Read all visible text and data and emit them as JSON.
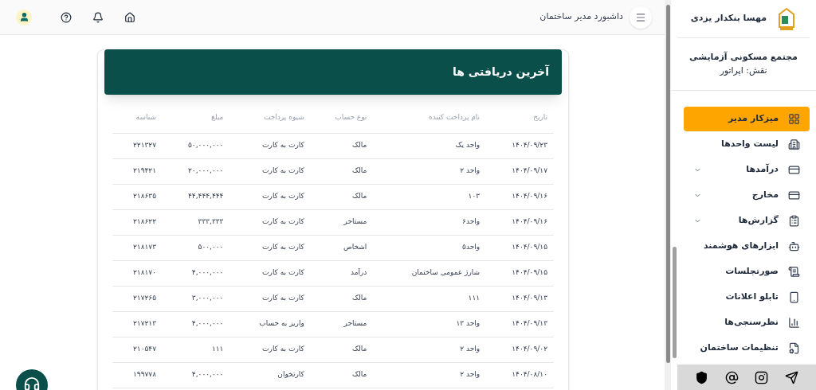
{
  "header": {
    "title": "داشبورد مدیر ساختمان"
  },
  "card": {
    "title": "آخرین دریافتی ها"
  },
  "table": {
    "columns": [
      "تاریخ",
      "نام پرداخت کننده",
      "نوع حساب",
      "شیوه پرداخت",
      "مبلغ",
      "شناسه"
    ],
    "rows": [
      [
        "۱۴۰۴/۰۹/۲۳",
        "واحد یک",
        "مالک",
        "کارت به کارت",
        "۵۰,۰۰۰,۰۰۰",
        "۲۲۱۳۲۷"
      ],
      [
        "۱۴۰۴/۰۹/۱۷",
        "واحد ۲",
        "مالک",
        "کارت به کارت",
        "۲۰,۰۰۰,۰۰۰",
        "۲۱۹۴۲۱"
      ],
      [
        "۱۴۰۴/۰۹/۱۶",
        "۱۰۳",
        "مالک",
        "کارت به کارت",
        "۴۴,۴۴۴,۴۴۴",
        "۲۱۸۶۳۵"
      ],
      [
        "۱۴۰۴/۰۹/۱۶",
        "واحد۶",
        "مستاجر",
        "کارت به کارت",
        "۳۳۳,۳۳۳",
        "۲۱۸۶۲۲"
      ],
      [
        "۱۴۰۴/۰۹/۱۵",
        "واحد۵",
        "اشخاص",
        "کارت به کارت",
        "۵۰۰,۰۰۰",
        "۲۱۸۱۷۳"
      ],
      [
        "۱۴۰۴/۰۹/۱۵",
        "شارژ عمومی ساختمان",
        "درآمد",
        "کارت به کارت",
        "۴,۰۰۰,۰۰۰",
        "۲۱۸۱۷۰"
      ],
      [
        "۱۴۰۴/۰۹/۱۳",
        "۱۱۱",
        "مالک",
        "کارت به کارت",
        "۳,۰۰۰,۰۰۰",
        "۲۱۷۲۶۵"
      ],
      [
        "۱۴۰۴/۰۹/۱۳",
        "واحد ۱۳",
        "مستاجر",
        "واریز به حساب",
        "۴,۰۰۰,۰۰۰",
        "۲۱۷۲۱۳"
      ],
      [
        "۱۴۰۴/۰۹/۰۲",
        "واحد ۲",
        "مالک",
        "کارت به کارت",
        "۱۱۱",
        "۲۱۰۵۴۷"
      ],
      [
        "۱۴۰۴/۰۸/۱۰",
        "واحد ۲",
        "مالک",
        "کارتخوان",
        "۴,۰۰۰,۰۰۰",
        "۱۹۹۷۷۸"
      ]
    ]
  },
  "sidebar": {
    "user": "مهسا بنکدار یزدی",
    "complex": "مجتمع مسکونی آزمایشی",
    "role": "نقش: اپراتور",
    "items": [
      {
        "label": "میزکار مدیر",
        "selected": true,
        "expandable": false
      },
      {
        "label": "لیست واحدها",
        "selected": false,
        "expandable": false
      },
      {
        "label": "درآمدها",
        "selected": false,
        "expandable": true
      },
      {
        "label": "مخارج",
        "selected": false,
        "expandable": true
      },
      {
        "label": "گزارش‌ها",
        "selected": false,
        "expandable": true
      },
      {
        "label": "ابزارهای هوشمند",
        "selected": false,
        "expandable": false
      },
      {
        "label": "صورتجلسات",
        "selected": false,
        "expandable": false
      },
      {
        "label": "تابلو اعلانات",
        "selected": false,
        "expandable": false
      },
      {
        "label": "نظرسنجی‌ها",
        "selected": false,
        "expandable": false
      },
      {
        "label": "تنظیمات ساختمان",
        "selected": false,
        "expandable": false
      }
    ]
  }
}
